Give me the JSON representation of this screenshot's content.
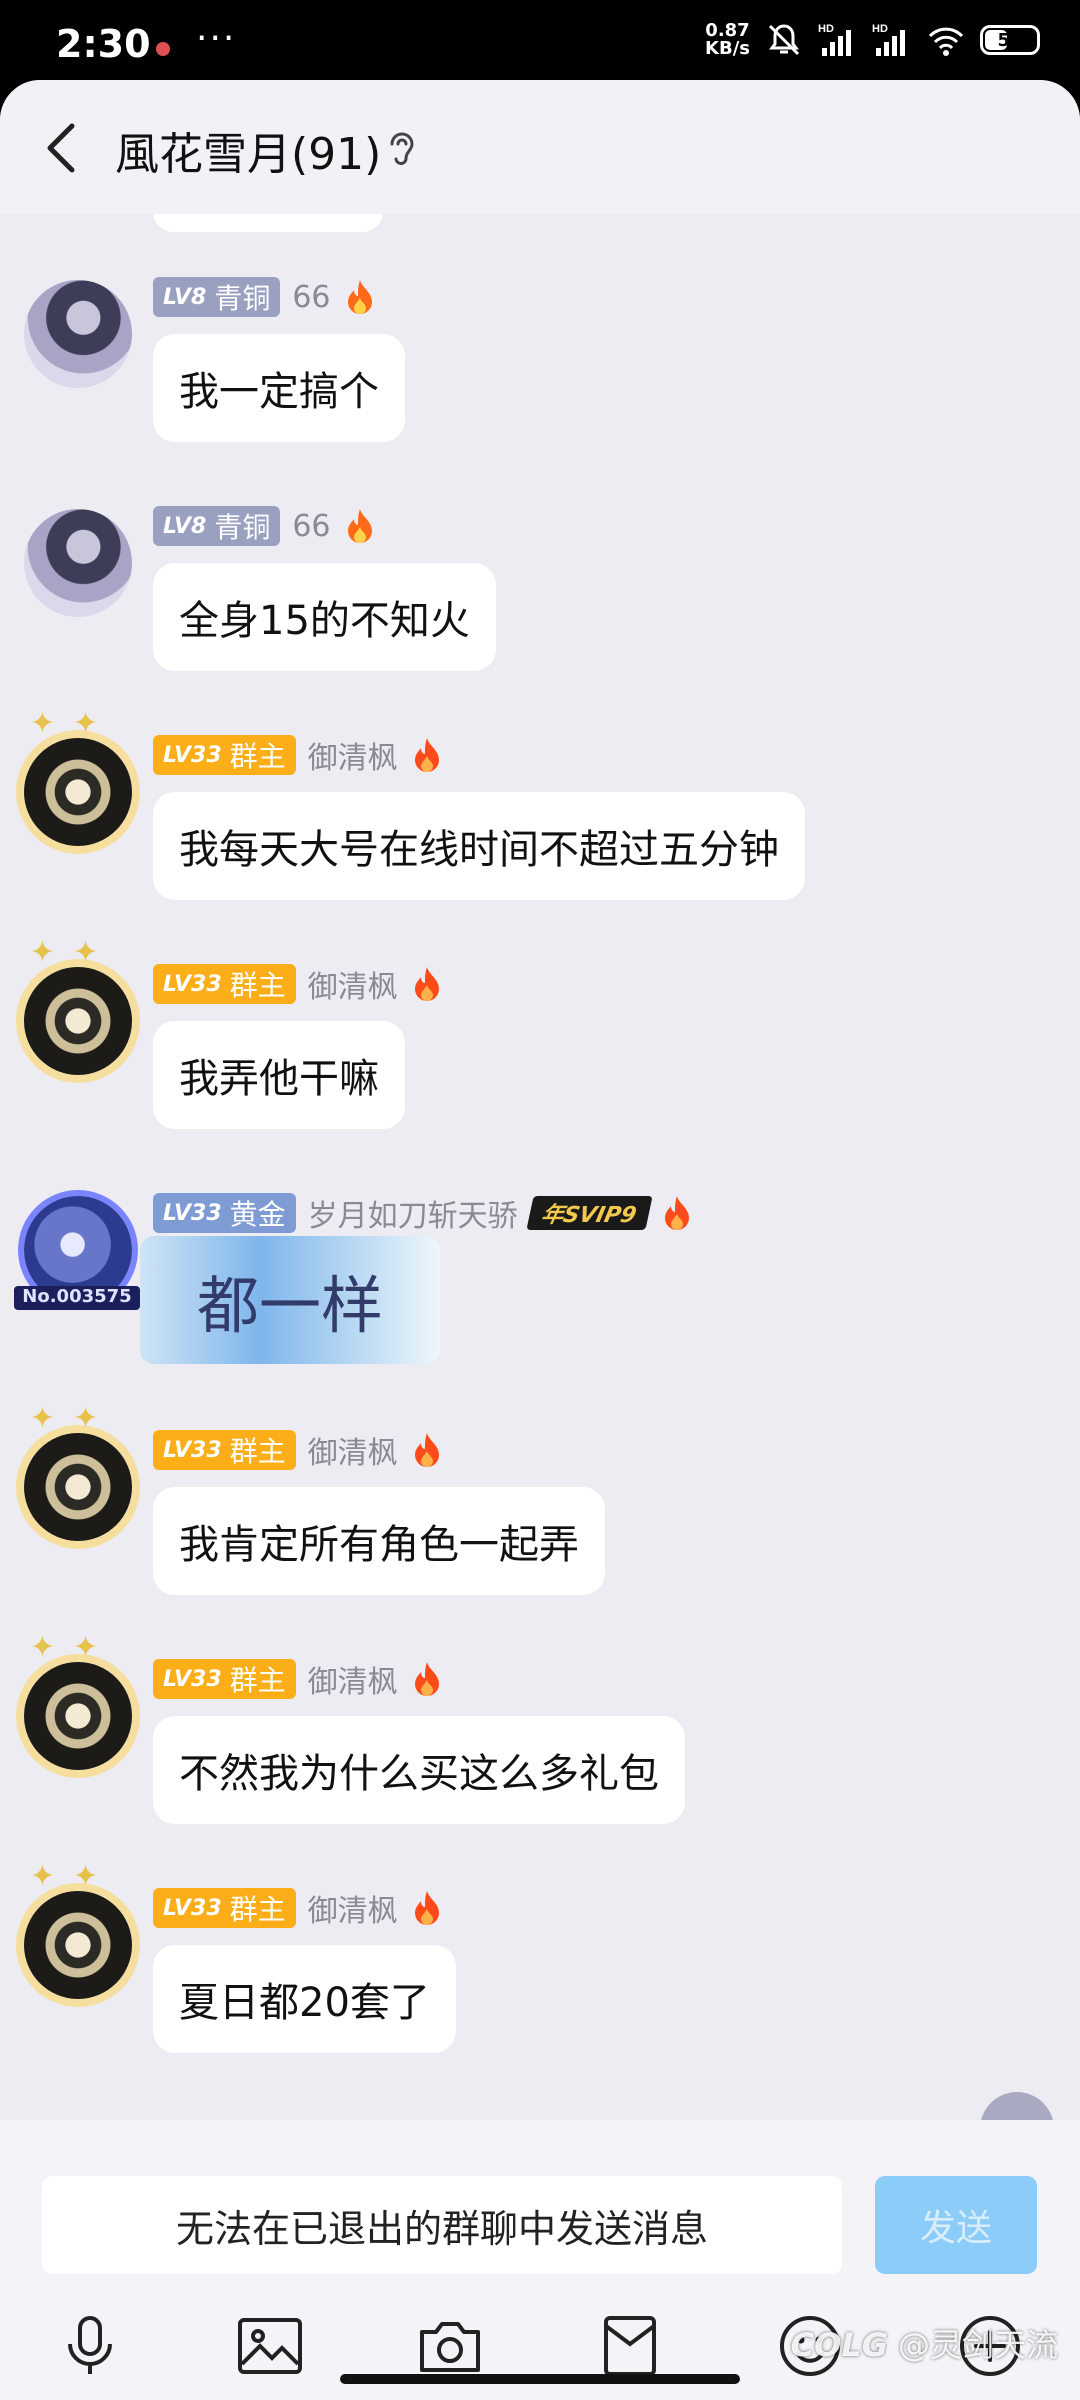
{
  "status_bar": {
    "time": "2:30",
    "more": "···",
    "speed_value": "0.87",
    "speed_unit": "KB/s",
    "battery": "57"
  },
  "header": {
    "title": "風花雪月(91)"
  },
  "messages": [
    {
      "level": "LV8",
      "title": "青铜",
      "nick": "66",
      "text": "我一定搞个"
    },
    {
      "level": "LV8",
      "title": "青铜",
      "nick": "66",
      "text": "全身15的不知火"
    },
    {
      "level": "LV33",
      "title": "群主",
      "nick": "御清枫",
      "text": "我每天大号在线时间不超过五分钟"
    },
    {
      "level": "LV33",
      "title": "群主",
      "nick": "御清枫",
      "text": "我弄他干嘛"
    },
    {
      "level": "LV33",
      "title": "黄金",
      "nick": "岁月如刀斩天骄",
      "svip": "年SVIP9",
      "avatar_no": "No.003575",
      "text": "都一样"
    },
    {
      "level": "LV33",
      "title": "群主",
      "nick": "御清枫",
      "text": "我肯定所有角色一起弄"
    },
    {
      "level": "LV33",
      "title": "群主",
      "nick": "御清枫",
      "text": "不然我为什么买这么多礼包"
    },
    {
      "level": "LV33",
      "title": "群主",
      "nick": "御清枫",
      "text": "夏日都20套了"
    }
  ],
  "input": {
    "placeholder": "无法在已退出的群聊中发送消息",
    "send_label": "发送"
  },
  "watermark": {
    "brand": "COLG",
    "text": "@灵剑天流"
  },
  "colors": {
    "badge_bronze": "#9aa0c0",
    "badge_owner": "#fbae17",
    "badge_gold": "#7f9bd4",
    "send_disabled": "#8cccf8",
    "chat_bg": "#ececf2"
  }
}
